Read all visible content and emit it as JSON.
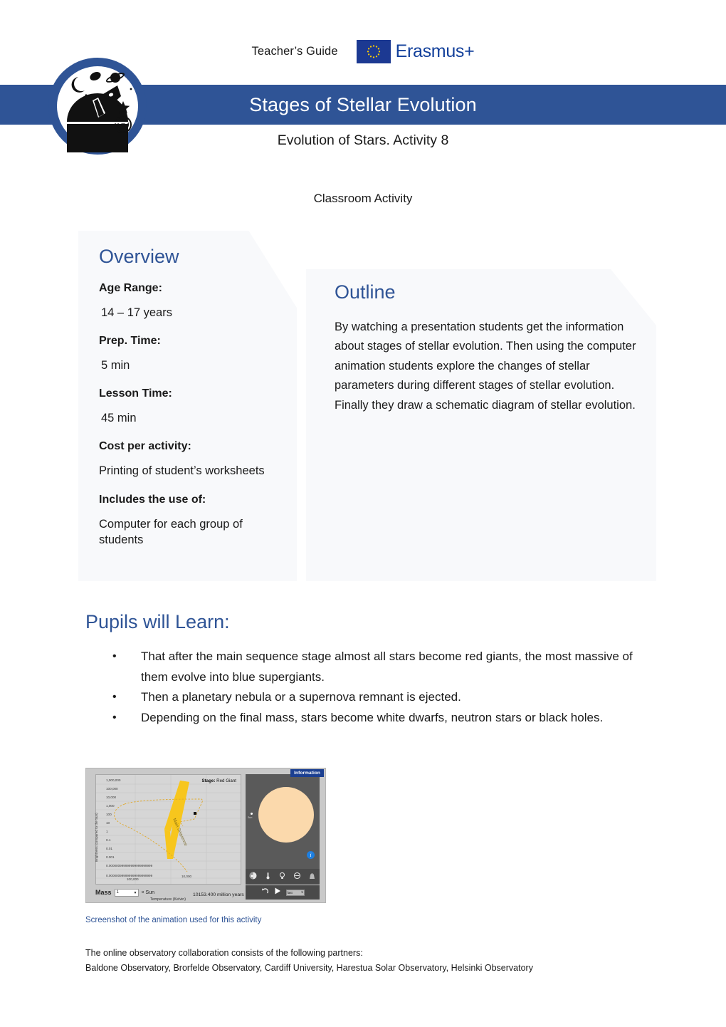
{
  "header": {
    "teachers_guide": "Teacher’s Guide",
    "erasmus_label": "Erasmus+",
    "eu_flag_icon": "eu-flag-icon",
    "banner_title": "Stages of Stellar Evolution",
    "subtitle": "Evolution of Stars. Activity 8",
    "classroom_activity": "Classroom Activity",
    "logo_icon": "observatory-dome-logo-icon",
    "banner_color": "#2F5496",
    "heading_color": "#2F5496"
  },
  "overview": {
    "heading": "Overview",
    "rows": [
      {
        "label": "Age Range:",
        "value": "14 – 17 years"
      },
      {
        "label": "Prep. Time:",
        "value": "5 min"
      },
      {
        "label": "Lesson Time:",
        "value": "45 min"
      },
      {
        "label": "Cost per activity:",
        "value": "Printing of student’s worksheets"
      },
      {
        "label": "Includes the use of:",
        "value": "Computer for each group of students"
      }
    ]
  },
  "outline": {
    "heading": "Outline",
    "body": "By watching a presentation students get the information about stages of stellar evolution. Then using the computer animation students explore the changes of stellar parameters during different stages of stellar evolution. Finally they draw a schematic diagram of stellar evolution."
  },
  "pupils": {
    "heading": "Pupils will Learn:",
    "bullet_glyph": "•",
    "items": [
      "That after the main sequence stage almost all stars become red giants, the most massive of them evolve into blue supergiants.",
      "Then a planetary nebula or a supernova remnant is ejected.",
      "Depending on the final mass, stars become white dwarfs, neutron stars or black holes."
    ]
  },
  "figure": {
    "caption": "Screenshot of the animation used for this activity",
    "information_button": "Information",
    "stage_label": "Stage:",
    "stage_value": "Red Giant",
    "mass_label": "Mass",
    "mass_value": "1",
    "mass_unit": "× Sun",
    "elapsed_time": "10153.400 million years",
    "speed_value": "fast",
    "sun_marker_label": "Sun",
    "info_icon": "info-circle-icon",
    "undo_icon": "reset-icon",
    "play_icon": "play-icon",
    "panel_icons": [
      "moon-phase-icon",
      "thermometer-icon",
      "lightbulb-icon",
      "circle-size-icon",
      "weight-icon"
    ],
    "chart_data": {
      "type": "scatter",
      "title": "",
      "xlabel": "Temperature (Kelvin)",
      "ylabel": "Brightness (compared to the Sun)",
      "xticks": [
        "100,000",
        "10,000"
      ],
      "yticks": [
        "1,000,000",
        "100,000",
        "10,000",
        "1,000",
        "100",
        "10",
        "1",
        "0.1",
        "0.01",
        "0.001",
        "0.000000999999999999999999",
        "0.000000999999999999999999"
      ],
      "annotations": [
        "Main Sequence"
      ],
      "series": [
        {
          "name": "Main Sequence band",
          "style": "filled-band",
          "color": "#f5c518"
        },
        {
          "name": "Evolutionary track",
          "style": "dashed-line",
          "color": "#e0a92c"
        },
        {
          "name": "Current star",
          "style": "point",
          "color": "#000000"
        }
      ],
      "grid": true,
      "legend": "none"
    }
  },
  "footer": {
    "line1": "The online observatory collaboration consists of the following partners:",
    "line2": "Baldone Observatory, Brorfelde Observatory, Cardiff University, Harestua Solar Observatory, Helsinki Observatory"
  }
}
